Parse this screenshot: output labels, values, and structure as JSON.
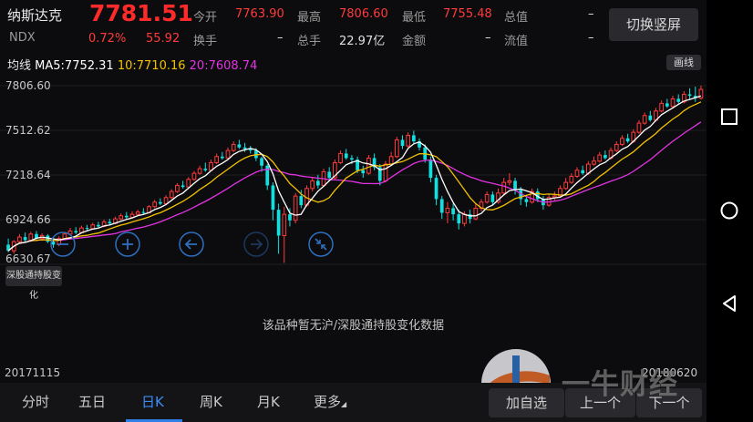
{
  "quote": {
    "name": "纳斯达克",
    "code": "NDX",
    "price": "7781.51",
    "change_pct": "0.72%",
    "change": "55.92",
    "fields": [
      {
        "label": "今开",
        "value": "7763.90"
      },
      {
        "label": "最高",
        "value": "7806.60"
      },
      {
        "label": "最低",
        "value": "7755.48"
      },
      {
        "label": "总值",
        "value": "–"
      },
      {
        "label": "换手",
        "value": "–"
      },
      {
        "label": "总手",
        "value": "22.97亿"
      },
      {
        "label": "金额",
        "value": "–"
      },
      {
        "label": "流值",
        "value": "–"
      }
    ],
    "switch_button": "切换竖屏"
  },
  "ma": {
    "label": "均线",
    "ma5": "MA5:7752.31",
    "ma10": "10:7710.16",
    "ma20": "20:7608.74",
    "draw_button": "画线",
    "colors": {
      "ma5": "#ffffff",
      "ma10": "#f2c100",
      "ma20": "#e233e2"
    }
  },
  "chart_data": {
    "type": "candlestick",
    "yticks": [
      "7806.60",
      "7512.62",
      "7218.64",
      "6924.66",
      "6630.67"
    ],
    "ylim": [
      6630.67,
      7806.6
    ],
    "x_start": "20171115",
    "x_end": "20180620",
    "colors": {
      "up": "#ff3b3b",
      "down": "#12e0e0"
    },
    "candles": [
      [
        6760,
        6720,
        6800,
        6710
      ],
      [
        6720,
        6780,
        6790,
        6700
      ],
      [
        6780,
        6810,
        6830,
        6770
      ],
      [
        6810,
        6790,
        6840,
        6775
      ],
      [
        6790,
        6830,
        6845,
        6780
      ],
      [
        6830,
        6800,
        6850,
        6795
      ],
      [
        6800,
        6820,
        6835,
        6785
      ],
      [
        6820,
        6780,
        6830,
        6770
      ],
      [
        6780,
        6760,
        6795,
        6740
      ],
      [
        6760,
        6800,
        6815,
        6750
      ],
      [
        6800,
        6830,
        6840,
        6790
      ],
      [
        6830,
        6850,
        6870,
        6820
      ],
      [
        6850,
        6840,
        6875,
        6830
      ],
      [
        6840,
        6870,
        6885,
        6835
      ],
      [
        6870,
        6865,
        6890,
        6850
      ],
      [
        6865,
        6890,
        6905,
        6860
      ],
      [
        6890,
        6880,
        6910,
        6870
      ],
      [
        6880,
        6910,
        6925,
        6875
      ],
      [
        6910,
        6900,
        6930,
        6890
      ],
      [
        6900,
        6930,
        6945,
        6895
      ],
      [
        6930,
        6950,
        6965,
        6920
      ],
      [
        6950,
        6940,
        6975,
        6930
      ],
      [
        6940,
        6960,
        6980,
        6935
      ],
      [
        6960,
        6975,
        6990,
        6950
      ],
      [
        6975,
        6970,
        7000,
        6960
      ],
      [
        6970,
        7010,
        7020,
        6965
      ],
      [
        7010,
        7040,
        7055,
        7000
      ],
      [
        7040,
        7030,
        7065,
        7020
      ],
      [
        7030,
        7070,
        7085,
        7025
      ],
      [
        7070,
        7110,
        7125,
        7060
      ],
      [
        7110,
        7150,
        7165,
        7100
      ],
      [
        7150,
        7140,
        7180,
        7130
      ],
      [
        7140,
        7190,
        7205,
        7135
      ],
      [
        7190,
        7230,
        7245,
        7180
      ],
      [
        7230,
        7260,
        7280,
        7220
      ],
      [
        7260,
        7250,
        7300,
        7240
      ],
      [
        7250,
        7300,
        7320,
        7245
      ],
      [
        7300,
        7340,
        7360,
        7290
      ],
      [
        7340,
        7330,
        7370,
        7320
      ],
      [
        7330,
        7380,
        7400,
        7325
      ],
      [
        7380,
        7420,
        7440,
        7370
      ],
      [
        7420,
        7400,
        7450,
        7390
      ],
      [
        7400,
        7390,
        7430,
        7370
      ],
      [
        7390,
        7380,
        7410,
        7360
      ],
      [
        7380,
        7330,
        7395,
        7310
      ],
      [
        7330,
        7280,
        7340,
        7240
      ],
      [
        7280,
        7150,
        7290,
        7120
      ],
      [
        7150,
        6990,
        7170,
        6920
      ],
      [
        6990,
        6820,
        7030,
        6700
      ],
      [
        6820,
        6960,
        7010,
        6640
      ],
      [
        6960,
        6920,
        7000,
        6880
      ],
      [
        6920,
        7080,
        7100,
        6900
      ],
      [
        7080,
        7020,
        7120,
        7000
      ],
      [
        7020,
        7130,
        7150,
        7010
      ],
      [
        7130,
        7180,
        7200,
        7110
      ],
      [
        7180,
        7150,
        7220,
        7130
      ],
      [
        7150,
        7240,
        7260,
        7140
      ],
      [
        7240,
        7200,
        7270,
        7180
      ],
      [
        7200,
        7300,
        7320,
        7190
      ],
      [
        7300,
        7360,
        7380,
        7290
      ],
      [
        7360,
        7330,
        7390,
        7320
      ],
      [
        7330,
        7320,
        7350,
        7290
      ],
      [
        7320,
        7250,
        7340,
        7230
      ],
      [
        7250,
        7230,
        7280,
        7200
      ],
      [
        7230,
        7330,
        7350,
        7220
      ],
      [
        7330,
        7270,
        7360,
        7250
      ],
      [
        7270,
        7180,
        7290,
        7150
      ],
      [
        7180,
        7290,
        7310,
        7170
      ],
      [
        7290,
        7340,
        7370,
        7280
      ],
      [
        7340,
        7450,
        7470,
        7330
      ],
      [
        7450,
        7410,
        7480,
        7390
      ],
      [
        7410,
        7480,
        7500,
        7400
      ],
      [
        7480,
        7440,
        7510,
        7420
      ],
      [
        7440,
        7400,
        7460,
        7380
      ],
      [
        7400,
        7320,
        7420,
        7300
      ],
      [
        7320,
        7200,
        7340,
        7170
      ],
      [
        7200,
        7060,
        7220,
        7020
      ],
      [
        7060,
        6970,
        7080,
        6930
      ],
      [
        6970,
        7000,
        7040,
        6900
      ],
      [
        7000,
        6960,
        7030,
        6920
      ],
      [
        6960,
        6900,
        6990,
        6860
      ],
      [
        6900,
        6960,
        6980,
        6880
      ],
      [
        6960,
        6930,
        6990,
        6900
      ],
      [
        6930,
        7000,
        7030,
        6920
      ],
      [
        7000,
        7040,
        7060,
        6980
      ],
      [
        7040,
        7090,
        7110,
        7030
      ],
      [
        7090,
        7040,
        7110,
        7020
      ],
      [
        7040,
        7100,
        7130,
        7030
      ],
      [
        7100,
        7170,
        7200,
        7090
      ],
      [
        7170,
        7180,
        7230,
        7150
      ],
      [
        7180,
        7120,
        7200,
        7090
      ],
      [
        7120,
        7060,
        7140,
        7020
      ],
      [
        7060,
        7040,
        7090,
        7010
      ],
      [
        7040,
        7110,
        7130,
        7030
      ],
      [
        7110,
        7060,
        7130,
        7040
      ],
      [
        7060,
        7020,
        7080,
        6990
      ],
      [
        7020,
        7070,
        7090,
        7010
      ],
      [
        7070,
        7080,
        7110,
        7050
      ],
      [
        7080,
        7130,
        7150,
        7070
      ],
      [
        7130,
        7170,
        7200,
        7120
      ],
      [
        7170,
        7210,
        7230,
        7160
      ],
      [
        7210,
        7250,
        7270,
        7200
      ],
      [
        7250,
        7230,
        7280,
        7220
      ],
      [
        7230,
        7290,
        7310,
        7220
      ],
      [
        7290,
        7310,
        7340,
        7280
      ],
      [
        7310,
        7350,
        7370,
        7300
      ],
      [
        7350,
        7330,
        7380,
        7320
      ],
      [
        7330,
        7380,
        7400,
        7320
      ],
      [
        7380,
        7420,
        7440,
        7370
      ],
      [
        7420,
        7460,
        7480,
        7410
      ],
      [
        7460,
        7440,
        7490,
        7430
      ],
      [
        7440,
        7500,
        7520,
        7430
      ],
      [
        7500,
        7560,
        7580,
        7490
      ],
      [
        7560,
        7610,
        7630,
        7550
      ],
      [
        7610,
        7580,
        7640,
        7570
      ],
      [
        7580,
        7640,
        7660,
        7570
      ],
      [
        7640,
        7690,
        7710,
        7630
      ],
      [
        7690,
        7670,
        7720,
        7660
      ],
      [
        7670,
        7720,
        7740,
        7660
      ],
      [
        7720,
        7700,
        7750,
        7690
      ],
      [
        7700,
        7750,
        7770,
        7690
      ],
      [
        7750,
        7740,
        7790,
        7720
      ],
      [
        7740,
        7725,
        7800,
        7700
      ],
      [
        7725,
        7782,
        7807,
        7715
      ]
    ]
  },
  "hk_button": "深股通持股变化",
  "hk_empty_text": "该品种暂无沪/深股通持股变化数据",
  "tabs": [
    "分时",
    "五日",
    "日K",
    "周K",
    "月K",
    "更多"
  ],
  "active_tab": "日K",
  "actions": [
    "加自选",
    "上一个",
    "下一个"
  ],
  "watermark": "一牛财经",
  "icons": {
    "zoom_out": "zoom-out-icon",
    "zoom_in": "zoom-in-icon",
    "left": "arrow-left-icon",
    "right": "arrow-right-icon",
    "reset": "collapse-icon",
    "nav_square": "recent-apps-icon",
    "nav_circle": "home-icon",
    "nav_back": "back-icon"
  }
}
